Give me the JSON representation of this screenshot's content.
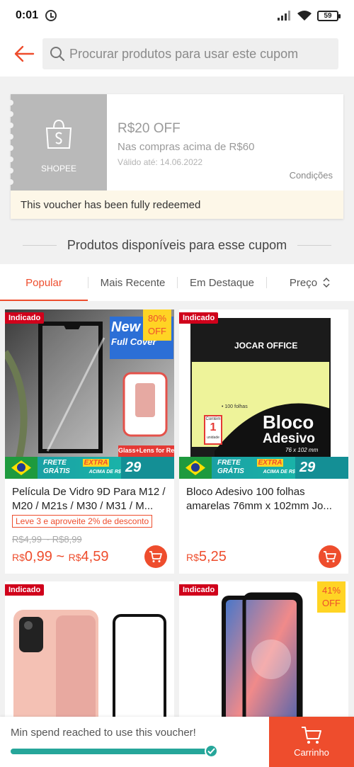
{
  "status_bar": {
    "time": "0:01",
    "battery": "59"
  },
  "header": {
    "search_placeholder": "Procurar produtos para usar este cupom"
  },
  "voucher": {
    "brand": "SHOPEE",
    "title": "R$20 OFF",
    "min_spend": "Nas compras acima de R$60",
    "valid_until": "Válido até: 14.06.2022",
    "conditions_label": "Condições",
    "status": "This voucher has been fully redeemed"
  },
  "section_title": "Produtos disponíveis para esse cupom",
  "tabs": [
    {
      "label": "Popular"
    },
    {
      "label": "Mais Recente"
    },
    {
      "label": "Em Destaque"
    },
    {
      "label": "Preço"
    }
  ],
  "products": [
    {
      "badge": "Indicado",
      "discount_pct": "80%",
      "discount_label": "OFF",
      "image_text_top": "New",
      "image_text_mid": "Full Cover",
      "image_text_bottom": "Glass+Lens for Redmi",
      "banner_frete": "FRETE",
      "banner_gratis": "GRÁTIS",
      "banner_extra": "EXTRA",
      "banner_acima": "ACIMA DE R$",
      "banner_value": "29",
      "name": "Película De Vidro 9D Para M12 / M20 / M21s / M30 / M31 / M...",
      "promo": "Leve 3 e aproveite 2% de desconto",
      "old_price": "R$4,99 ~ R$8,99",
      "price_currency": "R$",
      "price_low": "0,99",
      "price_sep": " ~ ",
      "price_currency2": "R$",
      "price_high": "4,59"
    },
    {
      "badge": "Indicado",
      "brand_on_pack": "JOCAR OFFICE",
      "pack_count": "• 100 folhas",
      "pack_contains": "Contém",
      "pack_units": "1",
      "pack_unit_label": "unidade",
      "pack_title1": "Bloco",
      "pack_title2": "Adesivo",
      "pack_size": "76 x 102 mm",
      "banner_frete": "FRETE",
      "banner_gratis": "GRÁTIS",
      "banner_extra": "EXTRA",
      "banner_acima": "ACIMA DE R$",
      "banner_value": "29",
      "name": "Bloco Adesivo 100 folhas amarelas 76mm x 102mm Jo...",
      "price_currency": "R$",
      "price": "5,25"
    },
    {
      "badge": "Indicado"
    },
    {
      "badge": "Indicado",
      "discount_pct": "41%",
      "discount_label": "OFF"
    }
  ],
  "bottom_bar": {
    "message": "Min spend reached to use this voucher!",
    "progress": 1.0,
    "cart_label": "Carrinho"
  },
  "colors": {
    "accent": "#ee4d2d",
    "progress": "#26a69a",
    "indicado": "#d0011b",
    "off_badge": "#ffd424"
  }
}
